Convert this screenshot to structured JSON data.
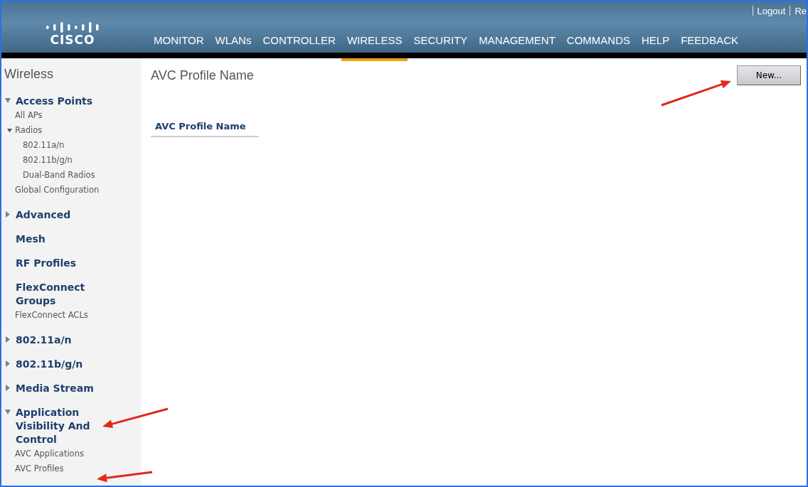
{
  "header": {
    "logo": "CISCO",
    "links": [
      "Logout",
      "Re"
    ],
    "nav": [
      {
        "label": "MONITOR",
        "selected": false
      },
      {
        "label": "WLANs",
        "selected": false
      },
      {
        "label": "CONTROLLER",
        "selected": false
      },
      {
        "label": "WIRELESS",
        "selected": true
      },
      {
        "label": "SECURITY",
        "selected": false
      },
      {
        "label": "MANAGEMENT",
        "selected": false
      },
      {
        "label": "COMMANDS",
        "selected": false
      },
      {
        "label": "HELP",
        "selected": false
      },
      {
        "label": "FEEDBACK",
        "selected": false
      }
    ]
  },
  "sidebar": {
    "title": "Wireless",
    "items": [
      {
        "label": "Access Points",
        "expanded": true,
        "children": [
          {
            "label": "All APs"
          },
          {
            "label": "Radios",
            "expanded": true,
            "children": [
              {
                "label": "802.11a/n"
              },
              {
                "label": "802.11b/g/n"
              },
              {
                "label": "Dual-Band Radios"
              }
            ]
          },
          {
            "label": "Global Configuration"
          }
        ]
      },
      {
        "label": "Advanced",
        "expanded": false
      },
      {
        "label": "Mesh"
      },
      {
        "label": "RF Profiles"
      },
      {
        "label": "FlexConnect Groups",
        "children": [
          {
            "label": "FlexConnect ACLs"
          }
        ]
      },
      {
        "label": "802.11a/n",
        "expanded": false
      },
      {
        "label": "802.11b/g/n",
        "expanded": false
      },
      {
        "label": "Media Stream",
        "expanded": false
      },
      {
        "label": "Application Visibility And Control",
        "expanded": true,
        "children": [
          {
            "label": "AVC Applications"
          },
          {
            "label": "AVC Profiles"
          }
        ]
      }
    ]
  },
  "content": {
    "title": "AVC Profile Name",
    "new_button": "New...",
    "table": {
      "columns": [
        "AVC Profile Name"
      ]
    }
  }
}
